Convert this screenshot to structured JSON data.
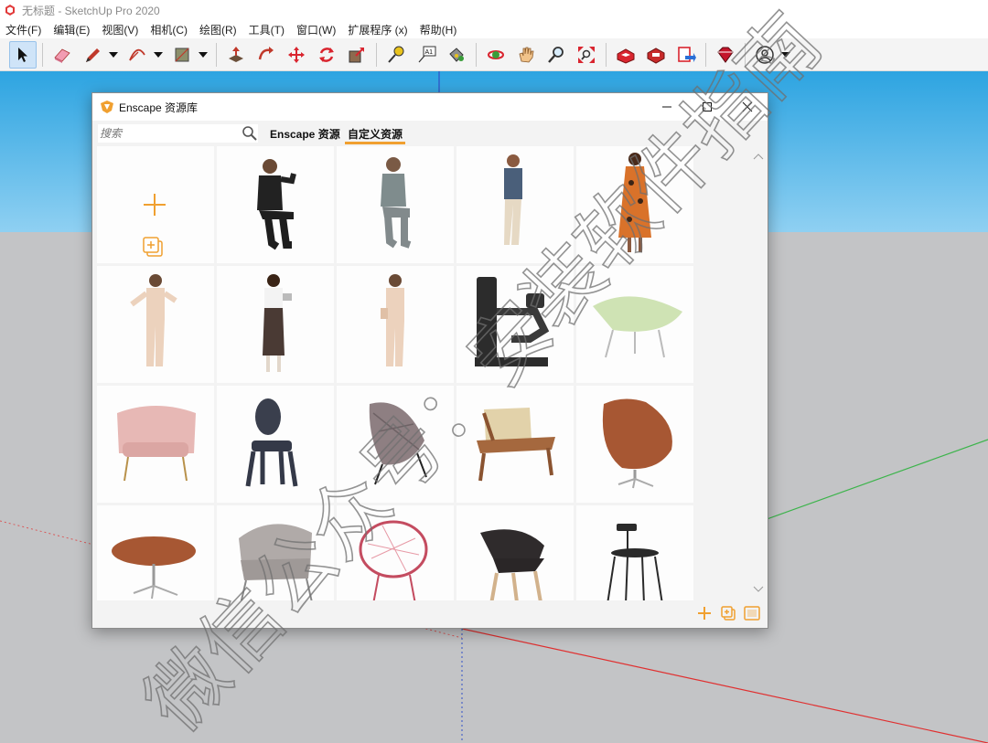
{
  "app": {
    "title": "无标题 - SketchUp Pro 2020"
  },
  "menu": [
    "文件(F)",
    "编辑(E)",
    "视图(V)",
    "相机(C)",
    "绘图(R)",
    "工具(T)",
    "窗口(W)",
    "扩展程序 (x)",
    "帮助(H)"
  ],
  "toolbar": {
    "tools": [
      "select-icon",
      "eraser-icon",
      "pencil-icon",
      "arc-icon",
      "rectangle-icon",
      "push-pull-icon",
      "follow-me-icon",
      "move-icon",
      "rotate-icon",
      "scale-icon",
      "tape-measure-icon",
      "text-icon",
      "paint-bucket-icon",
      "orbit-icon",
      "pan-icon",
      "zoom-icon",
      "zoom-extents-icon",
      "3d-warehouse-icon",
      "extension-warehouse-icon",
      "layout-icon",
      "extension-manager-icon",
      "user-icon"
    ],
    "text_tool_label": "A1",
    "active_tool": "select-icon"
  },
  "enscape_window": {
    "title": "Enscape 资源库",
    "search_placeholder": "搜索",
    "tabs": [
      "Enscape 资源",
      "自定义资源"
    ],
    "active_tab": "自定义资源",
    "accent_color": "#f0a030",
    "assets": [
      "add-asset",
      "man-seated-jacket",
      "man-seated-phone",
      "man-standing-phone",
      "woman-floral-dress",
      "woman-beige-suit-gesturing",
      "woman-apron-tablet",
      "woman-beige-suit-bag",
      "gym-machine",
      "green-shell-chair",
      "pink-armchair",
      "ghost-chair",
      "gray-lounge-chair",
      "rope-lounge-chair",
      "egg-chair",
      "egg-footstool",
      "womb-chair",
      "acapulco-chair",
      "shell-chair",
      "black-bar-stool"
    ]
  },
  "watermark": "微信公众号：安装软件指南",
  "colors": {
    "sky_top": "#2da4e1",
    "sky_bottom": "#8fd0f2",
    "ground": "#c3c4c6",
    "axis_red": "#e03030",
    "axis_green": "#3cb44b",
    "axis_blue": "#3050c8"
  }
}
